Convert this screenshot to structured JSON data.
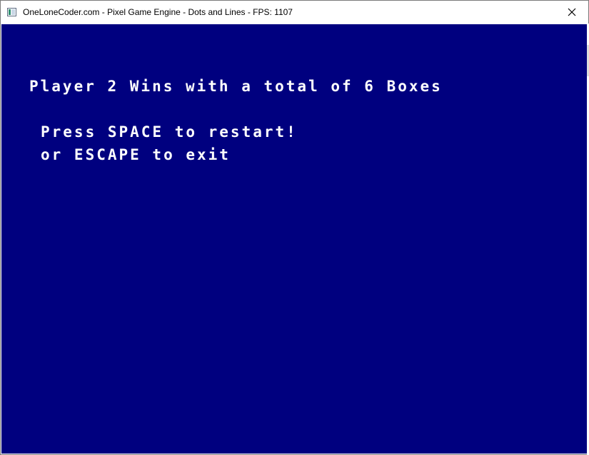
{
  "window": {
    "title": "OneLoneCoder.com - Pixel Game Engine - Dots and Lines - FPS: 1107",
    "icon": "app-window-icon",
    "close_icon": "close-icon"
  },
  "game_screen": {
    "background_color": "#00007f",
    "text_color": "#ffffff",
    "winner_message": "Player 2 Wins with a total of 6 Boxes",
    "restart_message": "Press SPACE to restart!",
    "exit_message": "or ESCAPE to exit"
  }
}
